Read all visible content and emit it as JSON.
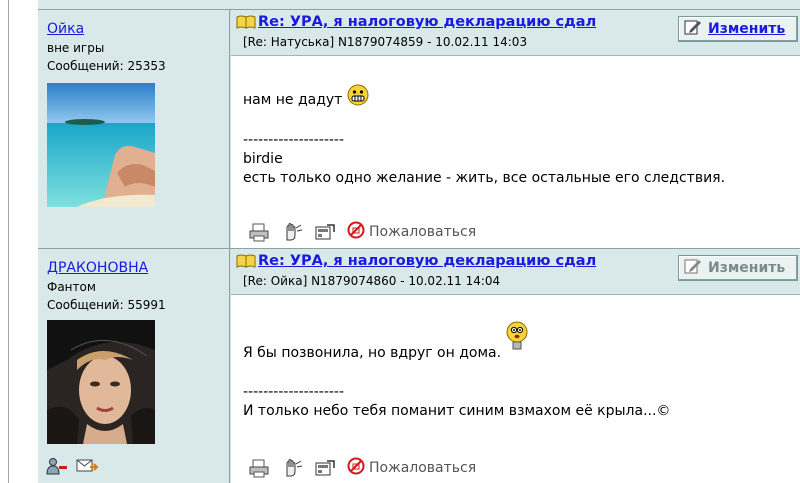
{
  "posts": [
    {
      "author": {
        "name": "Ойка",
        "status": "вне игры",
        "messages": "Сообщений: 25353"
      },
      "title": "Re: УРА, я налоговую декларацию сдал",
      "meta": "[Re: Натуська]  N1879074859 - 10.02.11 14:03",
      "edit_label": "Изменить",
      "body": {
        "text": "нам не дадут",
        "emoticon": "grin-smiley-icon",
        "divider": "--------------------",
        "signature_line1": "birdie",
        "signature_line2": "есть только одно желание - жить, все остальные его следствия."
      },
      "report_label": "Пожаловаться"
    },
    {
      "author": {
        "name": "ДРАКОНОВНА",
        "status": "Фантом",
        "messages": "Сообщений: 55991"
      },
      "title": "Re: УРА, я налоговую декларацию сдал",
      "meta": "[Re: Ойка]  N1879074860 - 10.02.11 14:04",
      "edit_label": "Изменить",
      "body": {
        "text": "Я бы позвонила, но вдруг он дома.",
        "emoticon": "lightbulb-smiley-icon",
        "divider": "--------------------",
        "signature_line1": "И только небо тебя поманит синим взмахом её крыла...©"
      },
      "report_label": "Пожаловаться"
    }
  ],
  "colors": {
    "link": "#1a1ae0",
    "header_bg": "#d9e8e8",
    "border": "#8aa4a4",
    "disabled_text": "#7e8a8a"
  }
}
